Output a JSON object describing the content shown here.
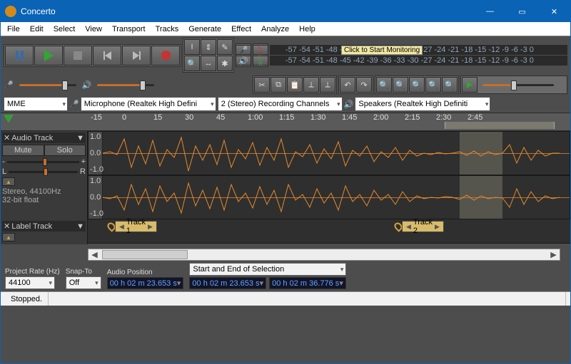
{
  "window": {
    "title": "Concerto"
  },
  "menu": [
    "File",
    "Edit",
    "Select",
    "View",
    "Transport",
    "Tracks",
    "Generate",
    "Effect",
    "Analyze",
    "Help"
  ],
  "transport": {
    "pause": "Pause",
    "play": "Play",
    "stop": "Stop",
    "skip_start": "Skip to Start",
    "skip_end": "Skip to End",
    "record": "Record"
  },
  "tool_palette": [
    "selection-tool",
    "envelope-tool",
    "draw-tool",
    "zoom-tool",
    "timeshift-tool",
    "multi-tool"
  ],
  "rec_meter": {
    "ticks": "-57 -54 -51 -48 -45 -42 -39 -36 -33 -30 -27 -24 -21 -18 -15 -12  -9  -6  -3  0",
    "bubble": "Click to Start Monitoring"
  },
  "play_meter": {
    "ticks": "-57 -54 -51 -48 -45 -42 -39 -36 -33 -30 -27 -24 -21 -18 -15 -12  -9  -6  -3  0"
  },
  "edit_tools": [
    "cut",
    "copy",
    "paste",
    "trim",
    "silence",
    "undo",
    "redo",
    "zoom-in",
    "zoom-out",
    "fit-selection",
    "fit-project",
    "zoom-toggle"
  ],
  "mixer": {
    "rec_level": 0.75,
    "play_level": 0.75
  },
  "devices": {
    "host": "MME",
    "rec_device": "Microphone (Realtek High Defini",
    "rec_channels": "2 (Stereo) Recording Channels",
    "play_device": "Speakers (Realtek High Definiti"
  },
  "timeline_labels": [
    "-15",
    "0",
    "15",
    "30",
    "45",
    "1:00",
    "1:15",
    "1:30",
    "1:45",
    "2:00",
    "2:15",
    "2:30",
    "2:45"
  ],
  "audio_track": {
    "name": "Audio Track",
    "mute": "Mute",
    "solo": "Solo",
    "gain_minus": "-",
    "gain_plus": "+",
    "pan_L": "L",
    "pan_R": "R",
    "format": "Stereo, 44100Hz",
    "bits": "32-bit float",
    "amp_top": "1.0",
    "amp_mid": "0.0",
    "amp_bot": "-1.0"
  },
  "label_track": {
    "name": "Label Track",
    "labels": [
      {
        "pos": 28,
        "text": "Track 1"
      },
      {
        "pos": 430,
        "text": "Track 2"
      }
    ]
  },
  "selection_bar": {
    "project_rate_label": "Project Rate (Hz)",
    "project_rate": "44100",
    "snap_label": "Snap-To",
    "snap": "Off",
    "audio_pos_label": "Audio Position",
    "audio_pos": "00 h 02 m 23.653 s",
    "sel_mode": "Start and End of Selection",
    "sel_start": "00 h 02 m 23.653 s",
    "sel_end": "00 h 02 m 36.776 s"
  },
  "status": {
    "state": "Stopped."
  }
}
